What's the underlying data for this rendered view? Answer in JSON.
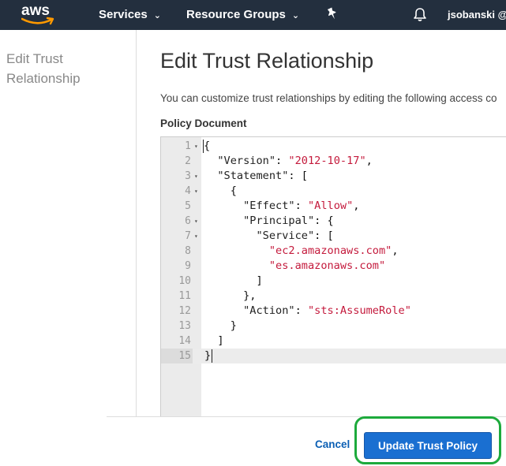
{
  "topbar": {
    "logo_text": "aws",
    "nav": [
      {
        "label": "Services"
      },
      {
        "label": "Resource Groups"
      }
    ],
    "user": "jsobanski @"
  },
  "sidebar": {
    "title": "Edit Trust Relationship"
  },
  "main": {
    "title": "Edit Trust Relationship",
    "description": "You can customize trust relationships by editing the following access co",
    "policy_label": "Policy Document"
  },
  "editor": {
    "lines": [
      {
        "n": "1",
        "fold": true
      },
      {
        "n": "2",
        "fold": false
      },
      {
        "n": "3",
        "fold": true
      },
      {
        "n": "4",
        "fold": true
      },
      {
        "n": "5",
        "fold": false
      },
      {
        "n": "6",
        "fold": true
      },
      {
        "n": "7",
        "fold": true
      },
      {
        "n": "8",
        "fold": false
      },
      {
        "n": "9",
        "fold": false
      },
      {
        "n": "10",
        "fold": false
      },
      {
        "n": "11",
        "fold": false
      },
      {
        "n": "12",
        "fold": false
      },
      {
        "n": "13",
        "fold": false
      },
      {
        "n": "14",
        "fold": false
      },
      {
        "n": "15",
        "fold": false
      }
    ],
    "tokens": {
      "open_brace": "{",
      "version_key": "\"Version\"",
      "version_val": "\"2012-10-17\"",
      "statement_key": "\"Statement\"",
      "effect_key": "\"Effect\"",
      "effect_val": "\"Allow\"",
      "principal_key": "\"Principal\"",
      "service_key": "\"Service\"",
      "service_1": "\"ec2.amazonaws.com\"",
      "service_2": "\"es.amazonaws.com\"",
      "action_key": "\"Action\"",
      "action_val": "\"sts:AssumeRole\""
    }
  },
  "footer": {
    "cancel_label": "Cancel",
    "update_label": "Update Trust Policy"
  },
  "colors": {
    "topbar": "#232f3e",
    "string": "#c41a3c",
    "primary_button": "#1a6fd1",
    "link": "#0b5fb4",
    "highlight": "#1daa3c"
  }
}
